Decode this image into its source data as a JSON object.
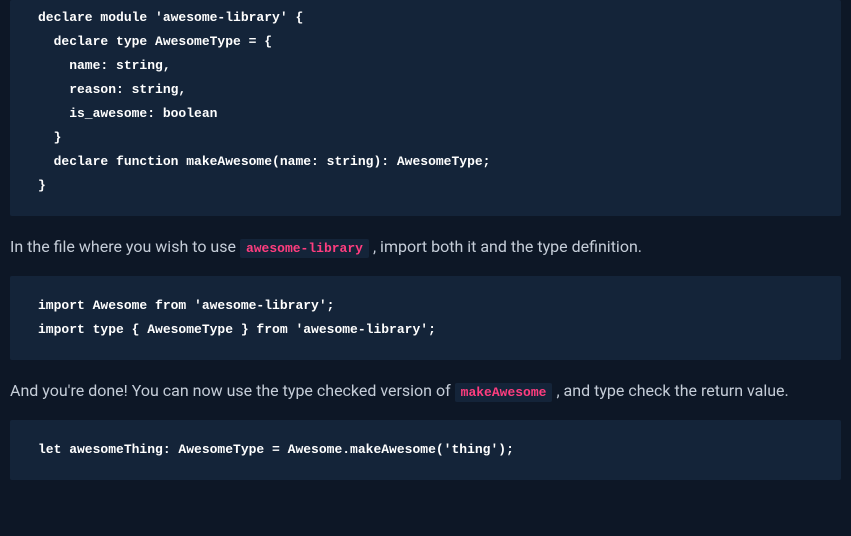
{
  "codeblocks": {
    "declare": "declare module 'awesome-library' {\n  declare type AwesomeType = {\n    name: string,\n    reason: string,\n    is_awesome: boolean\n  }\n  declare function makeAwesome(name: string): AwesomeType;\n}",
    "import": "import Awesome from 'awesome-library';\nimport type { AwesomeType } from 'awesome-library';",
    "usage": "let awesomeThing: AwesomeType = Awesome.makeAwesome('thing');"
  },
  "prose": {
    "p1_pre": "In the file where you wish to use ",
    "p1_code": "awesome-library",
    "p1_post": " , import both it and the type definition.",
    "p2_pre": "And you're done! You can now use the type checked version of ",
    "p2_code": "makeAwesome",
    "p2_post": " , and type check the return value."
  }
}
